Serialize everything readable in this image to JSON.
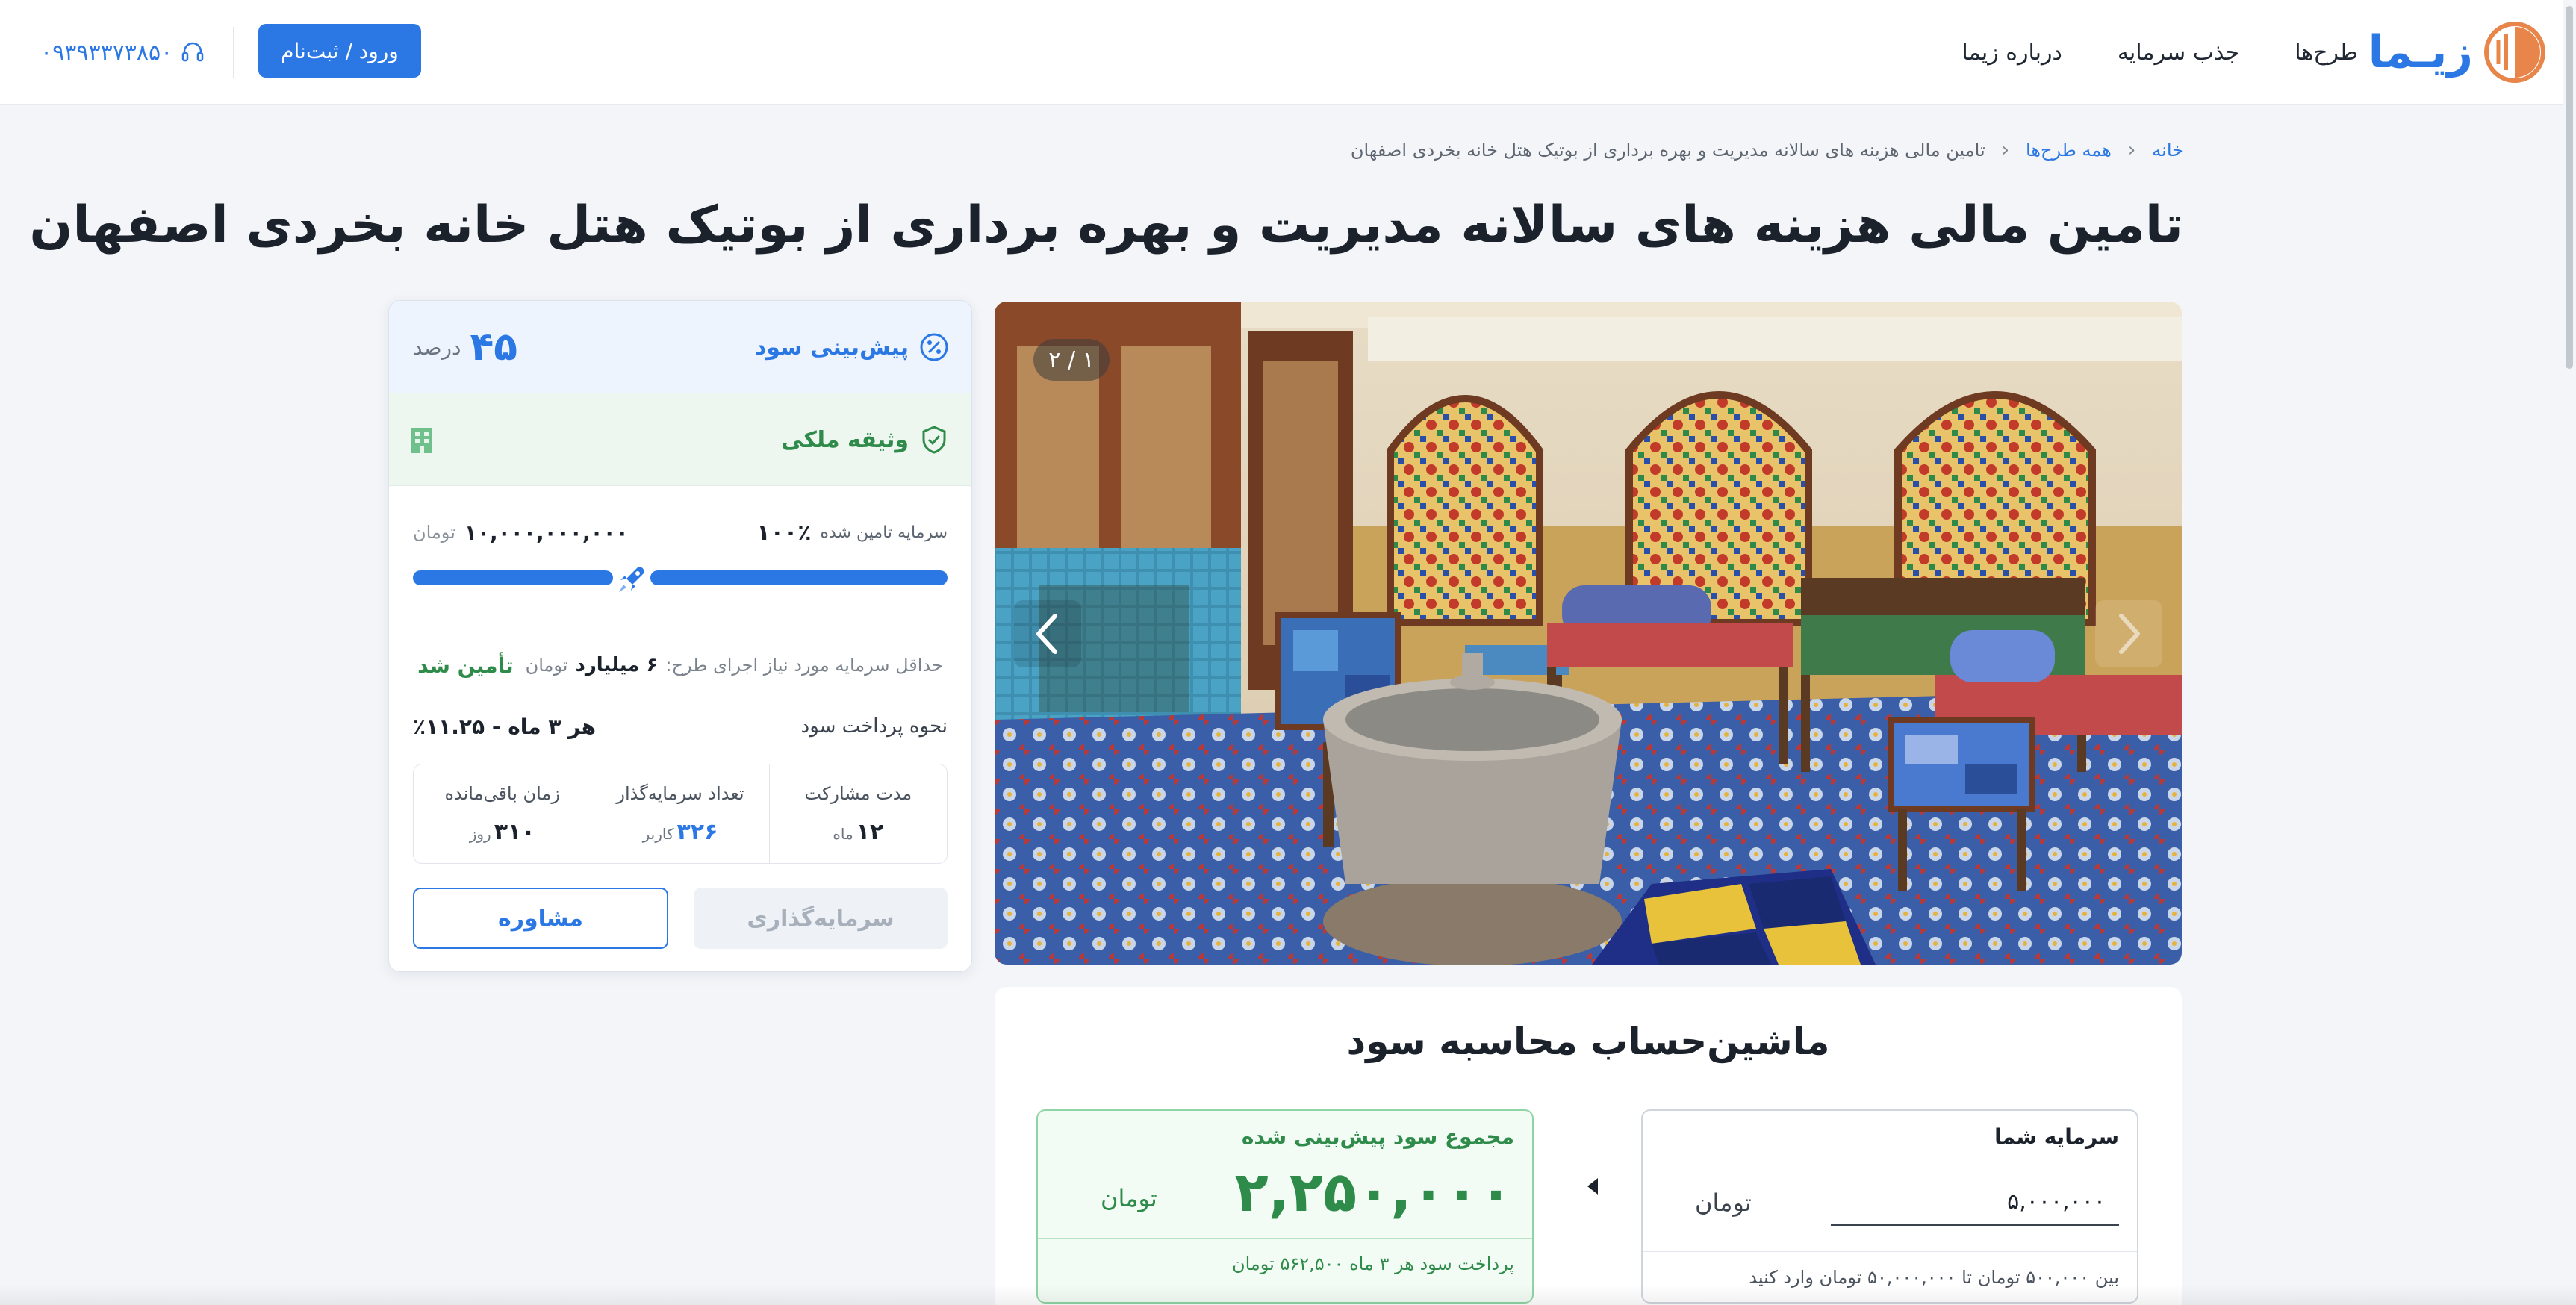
{
  "header": {
    "logo_text": "زیـما",
    "nav": [
      {
        "label": "طرح‌ها"
      },
      {
        "label": "جذب سرمایه"
      },
      {
        "label": "درباره زیما"
      }
    ],
    "login_label": "ورود / ثبت‌نام",
    "phone": "۰۹۳۹۳۳۷۳۸۵۰",
    "phone_icon": "headset-icon",
    "logo_icon": "zima-logo-icon",
    "accent_color": "#2b78e4"
  },
  "breadcrumb": {
    "home": "خانه",
    "all": "همه طرح‌ها",
    "current": "تامین مالی هزینه های سالانه مدیریت و بهره برداری از بوتیک هتل خانه بخردی اصفهان"
  },
  "title": "تامین مالی هزینه های سالانه مدیریت و بهره برداری از بوتیک هتل خانه بخردی اصفهان",
  "gallery": {
    "counter": "۲ / ۱",
    "prev_icon": "chevron-left-icon",
    "next_icon": "chevron-right-icon"
  },
  "invest": {
    "profit_label": "پیش‌بینی سود",
    "profit_value": "۴۵",
    "profit_unit": "درصد",
    "collateral_label": "وثیقه ملکی",
    "funded_label": "سرمایه تامین شده",
    "funded_percent": "۱۰۰٪",
    "funded_fraction": 1.0,
    "amount": "۱۰,۰۰۰,۰۰۰,۰۰۰",
    "amount_unit": "تومان",
    "min_label": "حداقل سرمایه مورد نیاز اجرای طرح:",
    "min_value": "۶ میلیارد",
    "min_unit": "تومان",
    "funded_status": "تأمین شد",
    "payment_label": "نحوه پرداخت سود",
    "payment_value": "هر ۳ ماه - ۱۱.۲۵٪",
    "stats": [
      {
        "label": "مدت مشارکت",
        "value": "۱۲",
        "unit": "ماه"
      },
      {
        "label": "تعداد سرمایه‌گذار",
        "value": "۳۲۶",
        "unit": "کاربر"
      },
      {
        "label": "زمان باقی‌مانده",
        "value": "۳۱۰",
        "unit": "روز"
      }
    ],
    "invest_button": "سرمایه‌گذاری",
    "consult_button": "مشاوره",
    "status_color": "#2e8b4a"
  },
  "calculator": {
    "title": "ماشین‌حساب محاسبه سود",
    "input_title": "سرمایه شما",
    "input_value": "۵,۰۰۰,۰۰۰",
    "input_unit": "تومان",
    "input_hint": "بین ۵۰۰,۰۰۰ تومان تا ۵۰,۰۰۰,۰۰۰ تومان وارد کنید",
    "result_title": "مجموع سود پیش‌بینی شده",
    "result_value": "۲,۲۵۰,۰۰۰",
    "result_unit": "تومان",
    "result_footer": "پرداخت سود هر ۳ ماه ۵۶۲,۵۰۰ تومان"
  }
}
